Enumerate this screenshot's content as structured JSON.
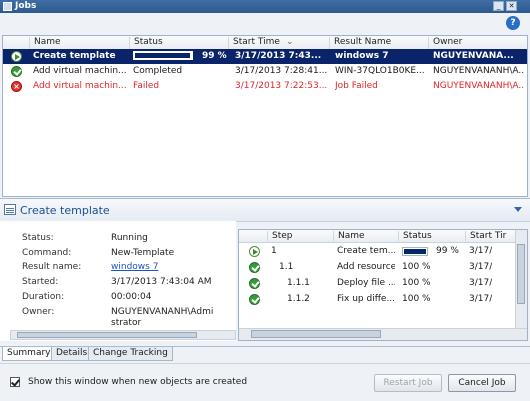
{
  "window": {
    "title": "Jobs"
  },
  "jobs": {
    "columns": [
      "Name",
      "Status",
      "Start Time",
      "Result Name",
      "Owner"
    ],
    "rows": [
      {
        "name": "Create template",
        "status": "",
        "progress": "99 %",
        "progress_fraction": 0.99,
        "start_time": "3/17/2013 7:43...",
        "result_name": "windows 7",
        "owner": "NGUYENVANA...",
        "icon": "running-icon",
        "state": "selected"
      },
      {
        "name": "Add virtual machin...",
        "status": "Completed",
        "progress": "",
        "start_time": "3/17/2013 7:28:41...",
        "result_name": "WIN-37QLO1B0KE...",
        "owner": "NGUYENVANANH\\A...",
        "icon": "completed-icon",
        "state": "normal"
      },
      {
        "name": "Add virtual machin...",
        "status": "Failed",
        "progress": "",
        "start_time": "3/17/2013 7:22:53...",
        "result_name": "Job Failed",
        "owner": "NGUYENVANANH\\A...",
        "icon": "failed-icon",
        "state": "failed"
      }
    ]
  },
  "detail": {
    "title": "Create template",
    "properties": [
      {
        "label": "Status:",
        "value": "Running"
      },
      {
        "label": "Command:",
        "value": "New-Template"
      },
      {
        "label": "Result name:",
        "value": "windows 7"
      },
      {
        "label": "Started:",
        "value": "3/17/2013 7:43:04 AM"
      },
      {
        "label": "Duration:",
        "value": "00:00:04"
      },
      {
        "label": "Owner:",
        "value": "NGUYENVANANH\\Admi"
      },
      {
        "label": "",
        "value": "strator"
      }
    ]
  },
  "steps": {
    "columns": [
      "Step",
      "Name",
      "Status",
      "Start Tir"
    ],
    "rows": [
      {
        "step": "1",
        "name": "Create tem...",
        "status": "99 %",
        "progress_fraction": 0.99,
        "start": "3/17/",
        "icon": "running-icon"
      },
      {
        "step": "1.1",
        "name": "Add resource",
        "status": "100 %",
        "start": "3/17/",
        "icon": "completed-icon"
      },
      {
        "step": "1.1.1",
        "name": "Deploy file ...",
        "status": "100 %",
        "start": "3/17/",
        "icon": "completed-icon"
      },
      {
        "step": "1.1.2",
        "name": "Fix up diffe...",
        "status": "100 %",
        "start": "3/17/",
        "icon": "completed-icon"
      }
    ]
  },
  "tabs": [
    "Summary",
    "Details",
    "Change Tracking"
  ],
  "footer": {
    "checkbox_label": "Show this window when new objects are created",
    "restart_label": "Restart Job",
    "cancel_label": "Cancel Job"
  },
  "colors": {
    "selection": "#0a246a",
    "failed_text": "#e0242a",
    "link": "#1a55c5"
  }
}
